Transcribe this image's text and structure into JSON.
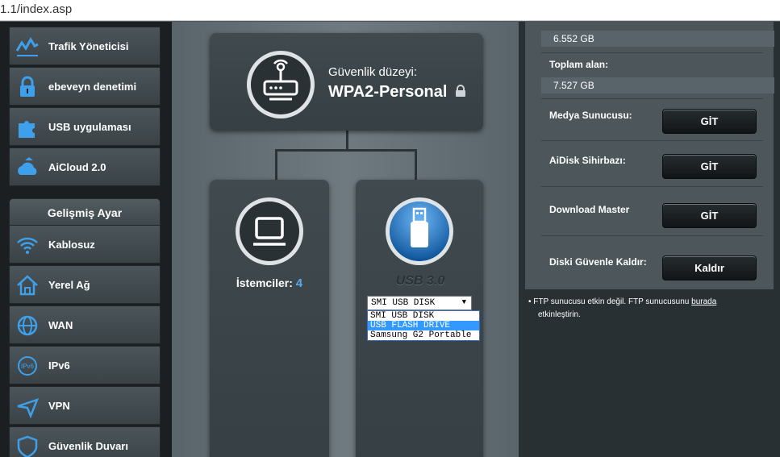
{
  "browser": {
    "url": "1.1/index.asp"
  },
  "sidebar": {
    "items": [
      {
        "label": "Trafik Yöneticisi",
        "icon": "traffic-icon"
      },
      {
        "label": "ebeveyn denetimi",
        "icon": "lock-icon"
      },
      {
        "label": "USB uygulaması",
        "icon": "puzzle-icon"
      },
      {
        "label": "AiCloud 2.0",
        "icon": "cloud-icon"
      }
    ],
    "advanced_header": "Gelişmiş Ayar",
    "advanced_items": [
      {
        "label": "Kablosuz",
        "icon": "wifi-icon"
      },
      {
        "label": "Yerel Ağ",
        "icon": "home-icon"
      },
      {
        "label": "WAN",
        "icon": "globe-icon"
      },
      {
        "label": "IPv6",
        "icon": "ipv6-icon"
      },
      {
        "label": "VPN",
        "icon": "vpn-icon"
      },
      {
        "label": "Güvenlik Duvarı",
        "icon": "shield-icon"
      }
    ]
  },
  "router": {
    "security_label": "Güvenlik düzeyi:",
    "security_value": "WPA2-Personal"
  },
  "clients": {
    "label": "İstemciler:",
    "count": "4"
  },
  "usb": {
    "title": "USB 3.0",
    "selected": "SMI USB DISK",
    "options": [
      "SMI USB DISK",
      "USB FLASH DRIVE",
      "Samsung G2 Portable"
    ],
    "highlighted_index": 1
  },
  "right": {
    "used": "6.552 GB",
    "total_label": "Toplam alan:",
    "total": "7.527 GB",
    "media_label": "Medya Sunucusu:",
    "media_btn": "GİT",
    "aidisk_label": "AiDisk Sihirbazı:",
    "aidisk_btn": "GİT",
    "dm_label": "Download Master",
    "dm_btn": "GİT",
    "eject_label": "Diski Güvenle Kaldır:",
    "eject_btn": "Kaldır",
    "note_pre": "FTP sunucusu etkin değil. FTP sunucusunu ",
    "note_link": "burada",
    "note_post": "etkinleştirin."
  },
  "colors": {
    "accent": "#5aa9e6",
    "sidebar_bg": "#1c1f21",
    "highlight": "#3399ff"
  }
}
